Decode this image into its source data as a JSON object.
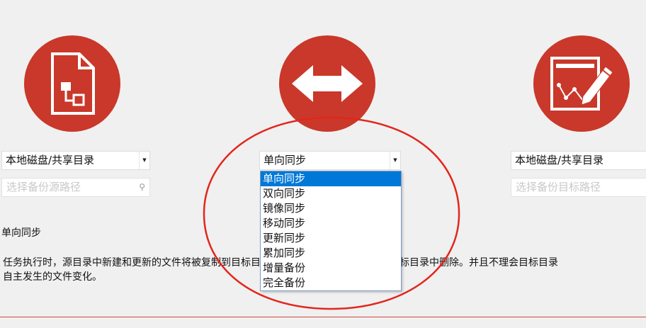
{
  "colors": {
    "brand_red": "#c9382a",
    "selection_blue": "#0078d7"
  },
  "icons": {
    "source": "document-icon",
    "mode": "bidirectional-arrow-icon",
    "target": "edit-document-icon"
  },
  "source": {
    "type_value": "本地磁盘/共享目录",
    "path_placeholder": "选择备份源路径"
  },
  "sync": {
    "selected": "单向同步",
    "options": [
      "单向同步",
      "双向同步",
      "镜像同步",
      "移动同步",
      "更新同步",
      "累加同步",
      "增量备份",
      "完全备份"
    ]
  },
  "target": {
    "type_value": "本地磁盘/共享目录",
    "path_placeholder": "选择备份目标路径"
  },
  "description": {
    "title": "单向同步",
    "line1": "任务执行时，源目录中新建和更新的文件将被复制到目标目录，源目录中删除的文件将在目标目录中删除。并且不理会目标目录",
    "line2": "自主发生的文件变化。"
  }
}
